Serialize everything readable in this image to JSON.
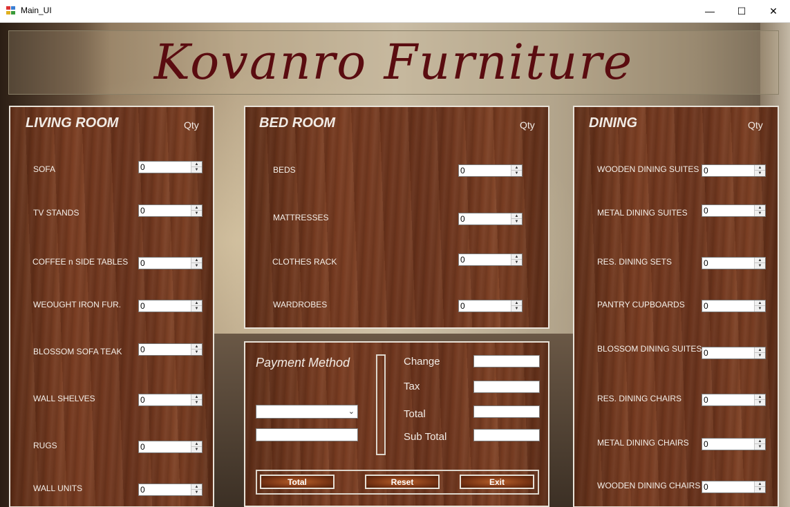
{
  "window": {
    "title": "Main_UI",
    "minimize": "—",
    "maximize": "☐",
    "close": "✕"
  },
  "banner": {
    "title": "Kovanro Furniture"
  },
  "living_room": {
    "title": "LIVING ROOM",
    "qty_label": "Qty",
    "items": [
      {
        "label": "SOFA",
        "value": "0"
      },
      {
        "label": "TV STANDS",
        "value": "0"
      },
      {
        "label": "COFFEE n SIDE TABLES",
        "value": "0"
      },
      {
        "label": "WEOUGHT IRON FUR.",
        "value": "0"
      },
      {
        "label": "BLOSSOM SOFA TEAK",
        "value": "0"
      },
      {
        "label": "WALL SHELVES",
        "value": "0"
      },
      {
        "label": "RUGS",
        "value": "0"
      },
      {
        "label": "WALL UNITS",
        "value": "0"
      }
    ]
  },
  "bed_room": {
    "title": "BED ROOM",
    "qty_label": "Qty",
    "items": [
      {
        "label": "BEDS",
        "value": "0"
      },
      {
        "label": "MATTRESSES",
        "value": "0"
      },
      {
        "label": "CLOTHES RACK",
        "value": "0"
      },
      {
        "label": "WARDROBES",
        "value": "0"
      }
    ]
  },
  "dining": {
    "title": "DINING",
    "qty_label": "Qty",
    "items": [
      {
        "label": "WOODEN DINING SUITES",
        "value": "0"
      },
      {
        "label": "METAL DINING SUITES",
        "value": "0"
      },
      {
        "label": "RES. DINING SETS",
        "value": "0"
      },
      {
        "label": "PANTRY CUPBOARDS",
        "value": "0"
      },
      {
        "label": "BLOSSOM DINING SUITES",
        "value": "0"
      },
      {
        "label": "RES. DINING CHAIRS",
        "value": "0"
      },
      {
        "label": "METAL DINING CHAIRS",
        "value": "0"
      },
      {
        "label": "WOODEN DINING CHAIRS",
        "value": "0"
      }
    ]
  },
  "payment": {
    "title": "Payment Method",
    "method_selected": "",
    "amount_value": "",
    "change_label": "Change",
    "tax_label": "Tax",
    "total_label": "Total",
    "subtotal_label": "Sub Total",
    "change_value": "",
    "tax_value": "",
    "total_value": "",
    "subtotal_value": "",
    "buttons": {
      "total": "Total",
      "reset": "Reset",
      "exit": "Exit"
    }
  }
}
